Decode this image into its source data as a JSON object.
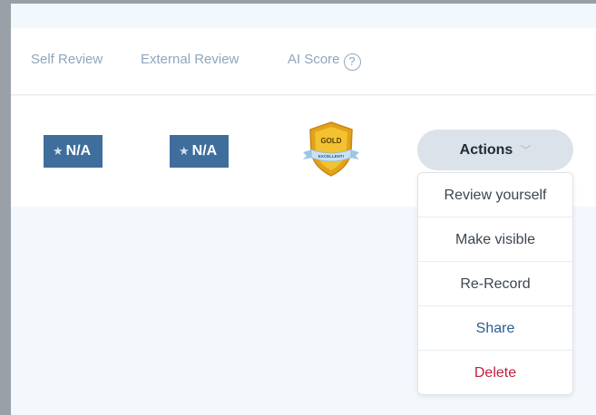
{
  "table": {
    "headers": {
      "self_review": "Self Review",
      "external_review": "External Review",
      "ai_score": "AI Score",
      "help_glyph": "?"
    },
    "row": {
      "self_review_badge": {
        "star": "★",
        "value": "N/A"
      },
      "external_review_badge": {
        "star": "★",
        "value": "N/A"
      },
      "ai_score_medal": {
        "label": "GOLD",
        "ribbon": "EXCELLENT!"
      }
    }
  },
  "actions": {
    "label": "Actions",
    "chevron": "﹀",
    "menu": [
      {
        "id": "review-yourself",
        "label": "Review yourself"
      },
      {
        "id": "make-visible",
        "label": "Make visible"
      },
      {
        "id": "re-record",
        "label": "Re-Record"
      },
      {
        "id": "share",
        "label": "Share"
      },
      {
        "id": "delete",
        "label": "Delete"
      }
    ]
  },
  "colors": {
    "badge": "#3f6e9c",
    "share": "#2a5d93",
    "delete": "#c0213f",
    "medal_gold": "#f2c230"
  },
  "icons": {
    "help": "question-circle-icon",
    "star": "star-icon",
    "medal": "gold-medal-shield-icon",
    "chevron": "chevron-down-icon"
  }
}
